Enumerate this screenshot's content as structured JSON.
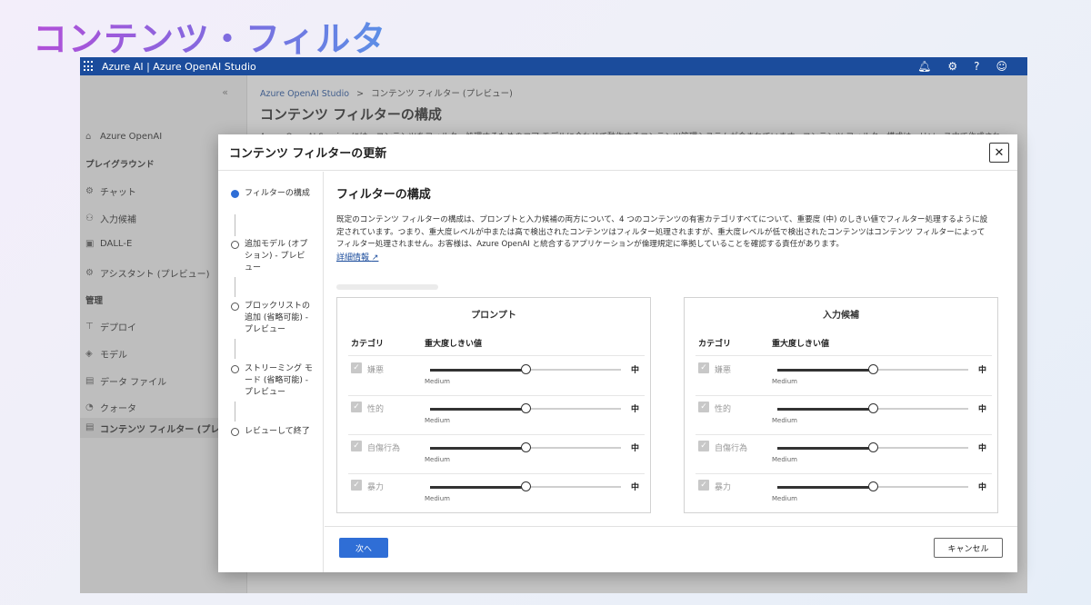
{
  "slide_title": "コンテンツ・フィルタ",
  "topbar": {
    "title": "Azure AI | Azure OpenAI Studio",
    "icons": [
      "bell-icon",
      "gear-icon",
      "help-icon",
      "smiley-icon"
    ]
  },
  "sidebar": {
    "collapse": "«",
    "home": "Azure OpenAI",
    "playground_heading": "プレイグラウンド",
    "chat": "チャット",
    "completions": "入力候補",
    "dalle": "DALL-E",
    "assistants": "アシスタント (プレビュー)",
    "manage_heading": "管理",
    "deployments": "デプロイ",
    "models": "モデル",
    "data_files": "データ ファイル",
    "quotas": "クォータ",
    "content_filters": "コンテンツ フィルター (プレビ"
  },
  "background_page": {
    "breadcrumb_root": "Azure OpenAI Studio",
    "breadcrumb_sep": ">",
    "breadcrumb_current": "コンテンツ フィルター (プレビュー)",
    "title": "コンテンツ フィルターの構成",
    "description": "Azure OpenAI Service には、コンテンツをフィルター処理するためのコア モデルに合わせて動作するコンテンツ管理システムが含まれています。コンテンツ フィルター構成は、リソース内で作成され..."
  },
  "dialog": {
    "title": "コンテンツ フィルターの更新",
    "close": "✕",
    "steps": [
      {
        "label": "フィルターの構成",
        "active": true
      },
      {
        "label": "追加モデル (オプション) - プレビュー",
        "active": false
      },
      {
        "label": "ブロックリストの追加 (省略可能) - プレビュー",
        "active": false
      },
      {
        "label": "ストリーミング モード (省略可能) - プレビュー",
        "active": false
      },
      {
        "label": "レビューして終了",
        "active": false
      }
    ],
    "heading": "フィルターの構成",
    "body": "既定のコンテンツ フィルターの構成は、プロンプトと入力候補の両方について、4 つのコンテンツの有害カテゴリすべてについて、重要度 (中) のしきい値でフィルター処理するように設定されています。つまり、重大度レベルが中または高で検出されたコンテンツはフィルター処理されますが、重大度レベルが低で検出されたコンテンツはコンテンツ フィルターによってフィルター処理されません。お客様は、Azure OpenAI と統合するアプリケーションが倫理規定に準拠していることを確認する責任があります。",
    "learn_more": "詳細情報",
    "prompt_panel": {
      "title": "プロンプト",
      "col_category": "カテゴリ",
      "col_threshold": "重大度しきい値",
      "rows": [
        {
          "category": "嫌悪",
          "level": "Medium",
          "value": "中",
          "position": 0.5
        },
        {
          "category": "性的",
          "level": "Medium",
          "value": "中",
          "position": 0.5
        },
        {
          "category": "自傷行為",
          "level": "Medium",
          "value": "中",
          "position": 0.5
        },
        {
          "category": "暴力",
          "level": "Medium",
          "value": "中",
          "position": 0.5
        }
      ]
    },
    "completion_panel": {
      "title": "入力候補",
      "col_category": "カテゴリ",
      "col_threshold": "重大度しきい値",
      "rows": [
        {
          "category": "嫌悪",
          "level": "Medium",
          "value": "中",
          "position": 0.5
        },
        {
          "category": "性的",
          "level": "Medium",
          "value": "中",
          "position": 0.5
        },
        {
          "category": "自傷行為",
          "level": "Medium",
          "value": "中",
          "position": 0.5
        },
        {
          "category": "暴力",
          "level": "Medium",
          "value": "中",
          "position": 0.5
        }
      ]
    },
    "next": "次へ",
    "cancel": "キャンセル"
  }
}
